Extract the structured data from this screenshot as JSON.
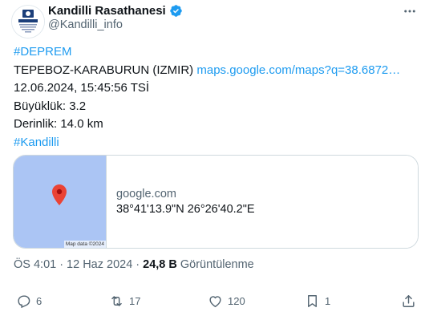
{
  "author": {
    "display_name": "Kandilli Rasathanesi",
    "handle": "@Kandilli_info",
    "avatar_logo_text": "KANDİLLİ",
    "avatar_icon": "kandilli-logo-icon",
    "verified_icon": "verified-badge-icon",
    "verified_color": "#1d9bf0"
  },
  "more_icon": "more-options-icon",
  "tweet": {
    "hashtag_top": "#DEPREM",
    "location": "TEPEBOZ-KARABURUN (IZMIR)",
    "map_link": "maps.google.com/maps?q=38.6872…",
    "datetime": "12.06.2024, 15:45:56 TSİ",
    "magnitude": "Büyüklük: 3.2",
    "depth": "Derinlik: 14.0 km",
    "hashtag_bottom": "#Kandilli",
    "link_color": "#1d9bf0"
  },
  "card": {
    "domain": "google.com",
    "title": "38°41'13.9\"N 26°26'40.2\"E",
    "map_credit": "Map data ©2024",
    "map_color": "#abc5f4",
    "pin_icon": "map-pin-icon",
    "pin_color": "#ea4335"
  },
  "meta": {
    "time": "ÖS 4:01",
    "separator": "·",
    "date": "12 Haz 2024",
    "views_count": "24,8 B",
    "views_label": "Görüntülenme"
  },
  "actions": {
    "replies": "6",
    "retweets": "17",
    "likes": "120",
    "bookmarks": "1",
    "reply_icon": "reply-icon",
    "retweet_icon": "retweet-icon",
    "like_icon": "heart-icon",
    "bookmark_icon": "bookmark-icon",
    "share_icon": "share-icon"
  }
}
